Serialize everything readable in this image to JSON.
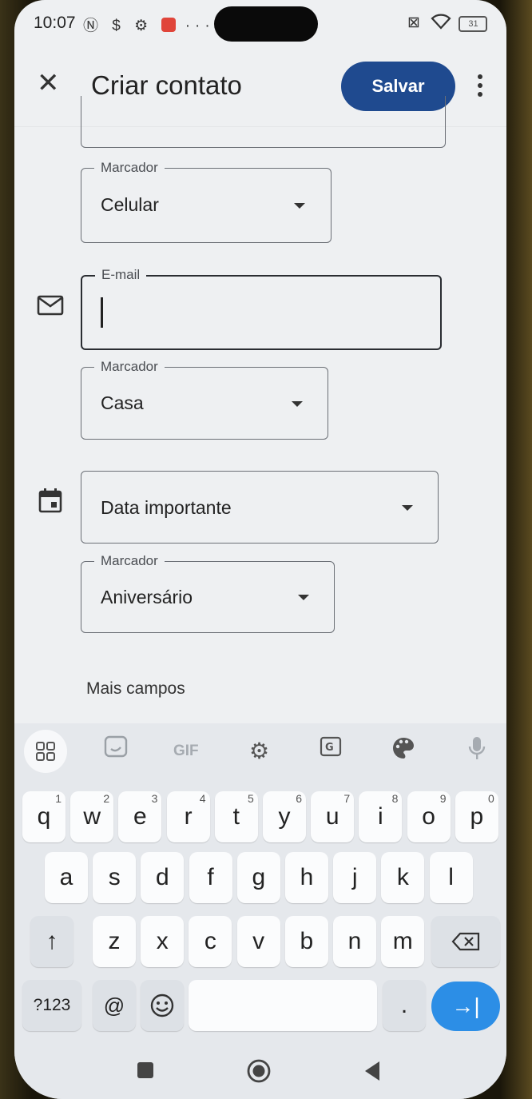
{
  "status_bar": {
    "time": "10:07",
    "left_icons": "Ⓝ $ ⚙",
    "more": "···",
    "battery": "31"
  },
  "app_bar": {
    "title": "Criar contato",
    "save_label": "Salvar"
  },
  "fields": {
    "phone_label": {
      "label": "Marcador",
      "value": "Celular"
    },
    "email": {
      "label": "E-mail",
      "value": ""
    },
    "email_label": {
      "label": "Marcador",
      "value": "Casa"
    },
    "event": {
      "value": "Data importante"
    },
    "event_label": {
      "label": "Marcador",
      "value": "Aniversário"
    }
  },
  "more_fields": "Mais campos",
  "keyboard": {
    "row1": [
      [
        "q",
        "1"
      ],
      [
        "w",
        "2"
      ],
      [
        "e",
        "3"
      ],
      [
        "r",
        "4"
      ],
      [
        "t",
        "5"
      ],
      [
        "y",
        "6"
      ],
      [
        "u",
        "7"
      ],
      [
        "i",
        "8"
      ],
      [
        "o",
        "9"
      ],
      [
        "p",
        "0"
      ]
    ],
    "row2": [
      "a",
      "s",
      "d",
      "f",
      "g",
      "h",
      "j",
      "k",
      "l"
    ],
    "row3": [
      "z",
      "x",
      "c",
      "v",
      "b",
      "n",
      "m"
    ],
    "symbols": "?123",
    "at": "@",
    "period": ".",
    "toolbar_gif": "GIF"
  }
}
